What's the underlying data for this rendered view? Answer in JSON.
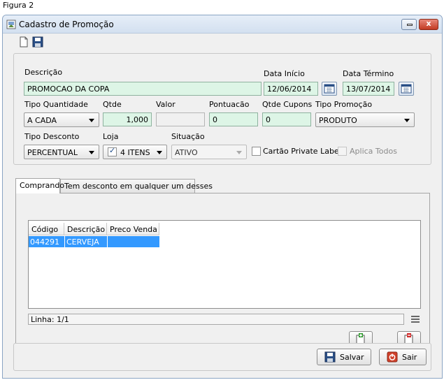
{
  "figure_caption": "Figura 2",
  "window": {
    "title": "Cadastro de Promoção",
    "close_glyph": "x"
  },
  "form": {
    "descricao_label": "Descrição",
    "descricao_value": "PROMOCAO DA COPA",
    "data_inicio_label": "Data Início",
    "data_inicio_value": "12/06/2014",
    "data_termino_label": "Data Término",
    "data_termino_value": "13/07/2014",
    "tipo_quantidade_label": "Tipo Quantidade",
    "tipo_quantidade_value": "A CADA",
    "qtde_label": "Qtde",
    "qtde_value": "1,000",
    "valor_label": "Valor",
    "valor_value": "",
    "pontuacao_label": "Pontuacão",
    "pontuacao_value": "0",
    "qtde_cupons_label": "Qtde Cupons",
    "qtde_cupons_value": "0",
    "tipo_promocao_label": "Tipo Promoção",
    "tipo_promocao_value": "PRODUTO",
    "tipo_desconto_label": "Tipo Desconto",
    "tipo_desconto_value": "PERCENTUAL",
    "loja_label": "Loja",
    "loja_value": "4 ITENS",
    "loja_checked": true,
    "situacao_label": "Situação",
    "situacao_value": "ATIVO",
    "cartao_label": "Cartão Private Label",
    "cartao_checked": false,
    "aplica_todos_label": "Aplica Todos",
    "aplica_todos_checked": false
  },
  "tabs": [
    {
      "label": "Comprando",
      "active": true
    },
    {
      "label": "Tem desconto em qualquer um desses",
      "active": false
    }
  ],
  "grid": {
    "columns": [
      "Código",
      "Descrição",
      "Preco Venda"
    ],
    "rows": [
      {
        "codigo": "044291",
        "descricao": "CERVEJA",
        "preco_venda": ""
      }
    ]
  },
  "status_line": "Linha: 1/1",
  "buttons": {
    "salvar": "Salvar",
    "sair": "Sair"
  },
  "colors": {
    "field_green": "#ddf5e6",
    "selection_blue": "#3399ff",
    "close_red": "#c23a22"
  },
  "icons": {
    "new_document": "new-document-icon",
    "save": "floppy-disk-icon",
    "calendar": "calendar-icon",
    "add_row": "add-row-icon",
    "remove_row": "remove-row-icon",
    "exit": "exit-icon",
    "menu": "hamburger-menu-icon"
  }
}
